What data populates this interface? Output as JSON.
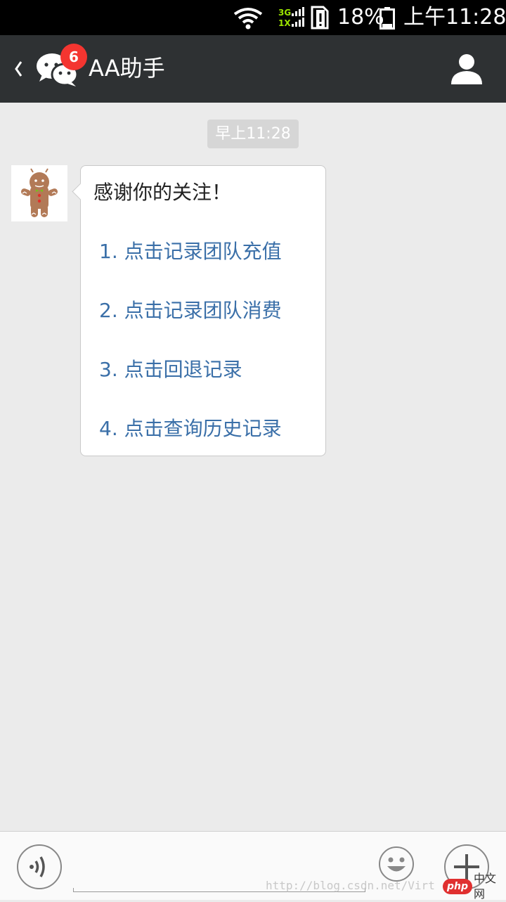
{
  "status_bar": {
    "network_top": "3G",
    "network_bottom": "1X",
    "battery_percent": "18%",
    "time": "上午11:28",
    "icons": [
      "wifi-icon",
      "signal-icon",
      "sim-alert-icon",
      "battery-icon"
    ]
  },
  "header": {
    "unread_badge": "6",
    "title": "AA助手",
    "icons": [
      "back-chevron-icon",
      "wechat-chat-icon",
      "person-icon"
    ],
    "background": "#2e3133"
  },
  "chat": {
    "timestamp": "早上11:28",
    "message": {
      "greeting": "感谢你的关注！",
      "links": [
        "1. 点击记录团队充值",
        "2. 点击记录团队消费",
        "3. 点击回退记录",
        "4. 点击查询历史记录"
      ],
      "link_color": "#3a6fa8"
    }
  },
  "input_bar": {
    "icons": [
      "voice-icon",
      "emoji-icon",
      "plus-icon"
    ]
  },
  "watermark": {
    "url": "http://blog.csdn.net/Virt",
    "logo_php": "php",
    "logo_cn": "中文网"
  }
}
